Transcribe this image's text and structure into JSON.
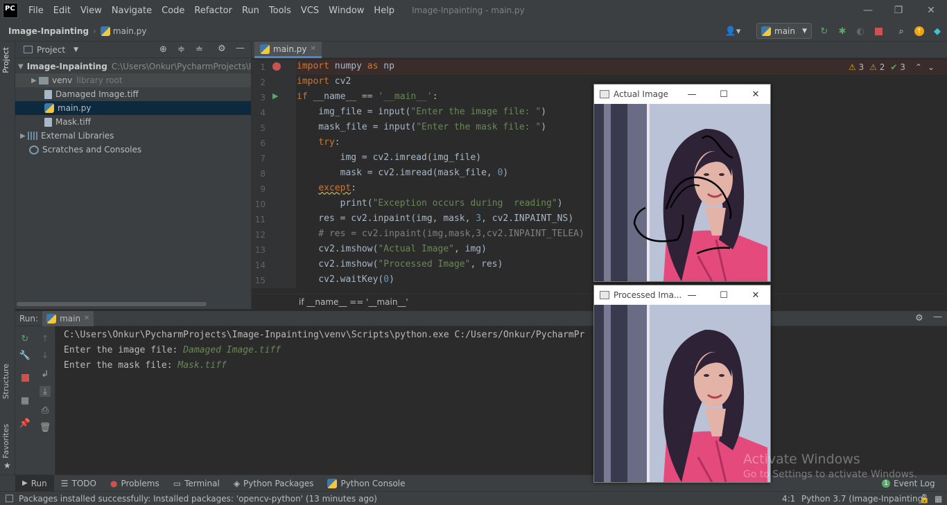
{
  "app": {
    "logo": "PC",
    "window_title": "Image-Inpainting - main.py"
  },
  "menu": [
    "File",
    "Edit",
    "View",
    "Navigate",
    "Code",
    "Refactor",
    "Run",
    "Tools",
    "VCS",
    "Window",
    "Help"
  ],
  "navbar": {
    "project": "Image-Inpainting",
    "file": "main.py",
    "run_config": "main"
  },
  "project_panel": {
    "title": "Project",
    "tree": [
      {
        "label": "Image-Inpainting",
        "extra": "C:\\Users\\Onkur\\PycharmProjects\\Im"
      },
      {
        "label": "venv",
        "extra": "library root"
      },
      {
        "label": "Damaged Image.tiff"
      },
      {
        "label": "main.py"
      },
      {
        "label": "Mask.tiff"
      },
      {
        "label": "External Libraries"
      },
      {
        "label": "Scratches and Consoles"
      }
    ]
  },
  "side_tabs": {
    "project": "Project",
    "structure": "Structure",
    "favorites": "Favorites"
  },
  "editor": {
    "tab": "main.py",
    "inspections": {
      "warnings": "3",
      "weak": "2",
      "ok": "3"
    },
    "line_numbers": [
      "1",
      "2",
      "3",
      "4",
      "5",
      "6",
      "7",
      "8",
      "9",
      "10",
      "11",
      "12",
      "13",
      "14",
      "15"
    ],
    "breadcrumb": "if __name__ == '__main__'"
  },
  "code": {
    "l1": [
      "import",
      " numpy ",
      "as",
      " np"
    ],
    "l2": [
      "import",
      " cv2"
    ],
    "l3": [
      "if",
      " __name__ == ",
      "'__main__'",
      ":"
    ],
    "l4": [
      "    img_file = input(",
      "\"Enter the image file: \"",
      ")"
    ],
    "l5": [
      "    mask_file = input(",
      "\"Enter the mask file: \"",
      ")"
    ],
    "l6": [
      "    ",
      "try",
      ":"
    ],
    "l7": [
      "        img = cv2.imread(img_file)"
    ],
    "l8": [
      "        mask = cv2.imread(mask_file, ",
      "0",
      ")"
    ],
    "l9": [
      "    ",
      "except",
      ":"
    ],
    "l10": [
      "        print(",
      "\"Exception occurs during  reading\"",
      ")"
    ],
    "l11": [
      "    res = cv2.inpaint(img, mask, ",
      "3",
      ", cv2.INPAINT_NS)"
    ],
    "l12": [
      "    # res = cv2.inpaint(img,mask,3,cv2.INPAINT_TELEA)"
    ],
    "l13": [
      "    cv2.imshow(",
      "\"Actual Image\"",
      ", img)"
    ],
    "l14": [
      "    cv2.imshow(",
      "\"Processed Image\"",
      ", res)"
    ],
    "l15": [
      "    cv2.waitKey(",
      "0",
      ")"
    ]
  },
  "run": {
    "label": "Run:",
    "tab": "main",
    "lines": [
      {
        "text": "C:\\Users\\Onkur\\PycharmProjects\\Image-Inpainting\\venv\\Scripts\\python.exe C:/Users/Onkur/PycharmPr",
        "input": ""
      },
      {
        "text": "Enter the image file: ",
        "input": "Damaged Image.tiff"
      },
      {
        "text": "Enter the mask file: ",
        "input": "Mask.tiff"
      }
    ]
  },
  "bottom_tabs": [
    "Run",
    "TODO",
    "Problems",
    "Terminal",
    "Python Packages",
    "Python Console"
  ],
  "event_log": {
    "count": "1",
    "label": "Event Log"
  },
  "status": {
    "message": "Packages installed successfully: Installed packages: 'opencv-python' (13 minutes ago)",
    "position": "4:1",
    "interpreter": "Python 3.7 (Image-Inpainting)"
  },
  "cv_windows": {
    "actual": {
      "title": "Actual Image"
    },
    "processed": {
      "title": "Processed Ima..."
    }
  },
  "watermark": {
    "line1": "Activate Windows",
    "line2": "Go to Settings to activate Windows."
  },
  "colors": {
    "accent": "#4a88c7",
    "keyword": "#cc7832",
    "string": "#6a8759",
    "number": "#6897bb",
    "blouse": "#e44a7c",
    "hair": "#2e2236"
  }
}
